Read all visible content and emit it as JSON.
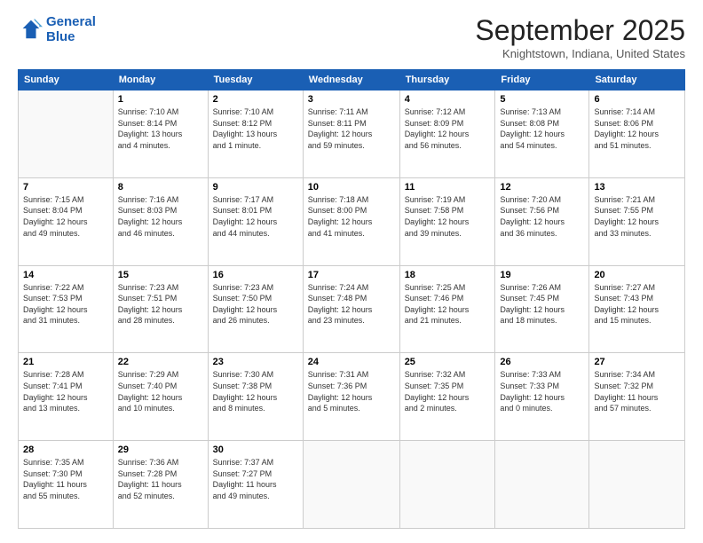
{
  "logo": {
    "line1": "General",
    "line2": "Blue"
  },
  "header": {
    "month": "September 2025",
    "location": "Knightstown, Indiana, United States"
  },
  "days_of_week": [
    "Sunday",
    "Monday",
    "Tuesday",
    "Wednesday",
    "Thursday",
    "Friday",
    "Saturday"
  ],
  "weeks": [
    [
      {
        "day": "",
        "info": ""
      },
      {
        "day": "1",
        "info": "Sunrise: 7:10 AM\nSunset: 8:14 PM\nDaylight: 13 hours\nand 4 minutes."
      },
      {
        "day": "2",
        "info": "Sunrise: 7:10 AM\nSunset: 8:12 PM\nDaylight: 13 hours\nand 1 minute."
      },
      {
        "day": "3",
        "info": "Sunrise: 7:11 AM\nSunset: 8:11 PM\nDaylight: 12 hours\nand 59 minutes."
      },
      {
        "day": "4",
        "info": "Sunrise: 7:12 AM\nSunset: 8:09 PM\nDaylight: 12 hours\nand 56 minutes."
      },
      {
        "day": "5",
        "info": "Sunrise: 7:13 AM\nSunset: 8:08 PM\nDaylight: 12 hours\nand 54 minutes."
      },
      {
        "day": "6",
        "info": "Sunrise: 7:14 AM\nSunset: 8:06 PM\nDaylight: 12 hours\nand 51 minutes."
      }
    ],
    [
      {
        "day": "7",
        "info": "Sunrise: 7:15 AM\nSunset: 8:04 PM\nDaylight: 12 hours\nand 49 minutes."
      },
      {
        "day": "8",
        "info": "Sunrise: 7:16 AM\nSunset: 8:03 PM\nDaylight: 12 hours\nand 46 minutes."
      },
      {
        "day": "9",
        "info": "Sunrise: 7:17 AM\nSunset: 8:01 PM\nDaylight: 12 hours\nand 44 minutes."
      },
      {
        "day": "10",
        "info": "Sunrise: 7:18 AM\nSunset: 8:00 PM\nDaylight: 12 hours\nand 41 minutes."
      },
      {
        "day": "11",
        "info": "Sunrise: 7:19 AM\nSunset: 7:58 PM\nDaylight: 12 hours\nand 39 minutes."
      },
      {
        "day": "12",
        "info": "Sunrise: 7:20 AM\nSunset: 7:56 PM\nDaylight: 12 hours\nand 36 minutes."
      },
      {
        "day": "13",
        "info": "Sunrise: 7:21 AM\nSunset: 7:55 PM\nDaylight: 12 hours\nand 33 minutes."
      }
    ],
    [
      {
        "day": "14",
        "info": "Sunrise: 7:22 AM\nSunset: 7:53 PM\nDaylight: 12 hours\nand 31 minutes."
      },
      {
        "day": "15",
        "info": "Sunrise: 7:23 AM\nSunset: 7:51 PM\nDaylight: 12 hours\nand 28 minutes."
      },
      {
        "day": "16",
        "info": "Sunrise: 7:23 AM\nSunset: 7:50 PM\nDaylight: 12 hours\nand 26 minutes."
      },
      {
        "day": "17",
        "info": "Sunrise: 7:24 AM\nSunset: 7:48 PM\nDaylight: 12 hours\nand 23 minutes."
      },
      {
        "day": "18",
        "info": "Sunrise: 7:25 AM\nSunset: 7:46 PM\nDaylight: 12 hours\nand 21 minutes."
      },
      {
        "day": "19",
        "info": "Sunrise: 7:26 AM\nSunset: 7:45 PM\nDaylight: 12 hours\nand 18 minutes."
      },
      {
        "day": "20",
        "info": "Sunrise: 7:27 AM\nSunset: 7:43 PM\nDaylight: 12 hours\nand 15 minutes."
      }
    ],
    [
      {
        "day": "21",
        "info": "Sunrise: 7:28 AM\nSunset: 7:41 PM\nDaylight: 12 hours\nand 13 minutes."
      },
      {
        "day": "22",
        "info": "Sunrise: 7:29 AM\nSunset: 7:40 PM\nDaylight: 12 hours\nand 10 minutes."
      },
      {
        "day": "23",
        "info": "Sunrise: 7:30 AM\nSunset: 7:38 PM\nDaylight: 12 hours\nand 8 minutes."
      },
      {
        "day": "24",
        "info": "Sunrise: 7:31 AM\nSunset: 7:36 PM\nDaylight: 12 hours\nand 5 minutes."
      },
      {
        "day": "25",
        "info": "Sunrise: 7:32 AM\nSunset: 7:35 PM\nDaylight: 12 hours\nand 2 minutes."
      },
      {
        "day": "26",
        "info": "Sunrise: 7:33 AM\nSunset: 7:33 PM\nDaylight: 12 hours\nand 0 minutes."
      },
      {
        "day": "27",
        "info": "Sunrise: 7:34 AM\nSunset: 7:32 PM\nDaylight: 11 hours\nand 57 minutes."
      }
    ],
    [
      {
        "day": "28",
        "info": "Sunrise: 7:35 AM\nSunset: 7:30 PM\nDaylight: 11 hours\nand 55 minutes."
      },
      {
        "day": "29",
        "info": "Sunrise: 7:36 AM\nSunset: 7:28 PM\nDaylight: 11 hours\nand 52 minutes."
      },
      {
        "day": "30",
        "info": "Sunrise: 7:37 AM\nSunset: 7:27 PM\nDaylight: 11 hours\nand 49 minutes."
      },
      {
        "day": "",
        "info": ""
      },
      {
        "day": "",
        "info": ""
      },
      {
        "day": "",
        "info": ""
      },
      {
        "day": "",
        "info": ""
      }
    ]
  ]
}
